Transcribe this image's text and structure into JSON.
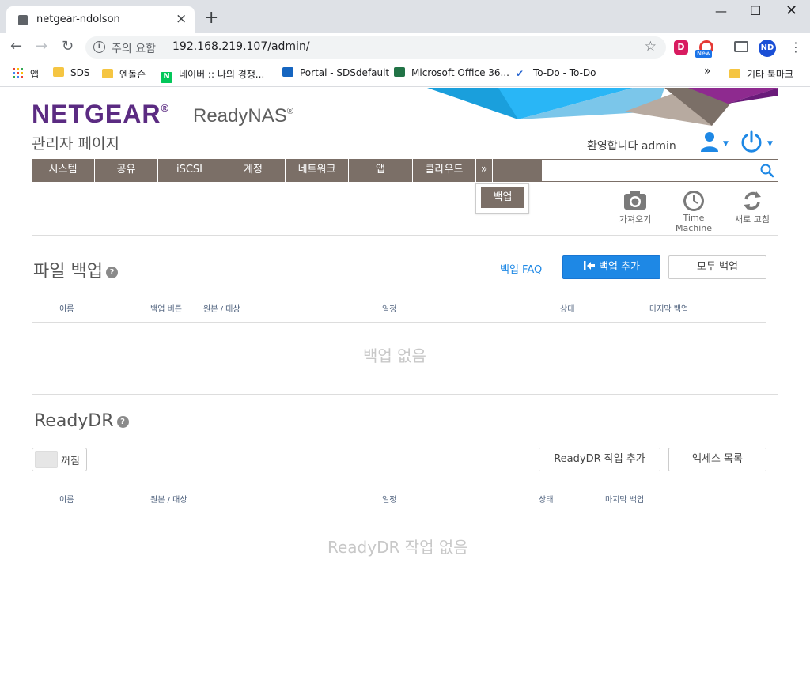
{
  "browser": {
    "tab_title": "netgear-ndolson",
    "new_tab": "+",
    "security_label": "주의 요함",
    "url": "192.168.219.107/admin/",
    "bookmarks": [
      {
        "label": "앱"
      },
      {
        "label": "SDS"
      },
      {
        "label": "엔돌슨"
      },
      {
        "label": "네이버 :: 나의 경쟁..."
      },
      {
        "label": "Portal - SDSdefault"
      },
      {
        "label": "Microsoft Office 36..."
      },
      {
        "label": "To-Do - To-Do"
      }
    ],
    "more_bookmarks": "»",
    "other_bookmarks": "기타 북마크",
    "ext_new_badge": "New",
    "profile_initials": "ND"
  },
  "header": {
    "logo": "NETGEAR",
    "logo_mark": "®",
    "product": "ReadyNAS",
    "product_mark": "®",
    "subtitle": "관리자 페이지",
    "welcome": "환영합니다 admin"
  },
  "nav": {
    "items": [
      "시스템",
      "공유",
      "iSCSI",
      "계정",
      "네트워크",
      "앱",
      "클라우드"
    ],
    "more": "»",
    "dropdown_item": "백업"
  },
  "tools": {
    "import": "가져오기",
    "time_machine": "Time Machine",
    "refresh": "새로 고침"
  },
  "file_backup": {
    "title": "파일 백업",
    "help": "?",
    "faq_link": "백업 FAQ",
    "add_button": "백업 추가",
    "backup_all_button": "모두 백업",
    "columns": [
      "이름",
      "백업 버튼",
      "원본 / 대상",
      "일정",
      "상태",
      "마지막 백업"
    ],
    "empty_text": "백업 없음"
  },
  "readydr": {
    "title": "ReadyDR",
    "help": "?",
    "toggle_label": "꺼짐",
    "add_job_button": "ReadyDR 작업 추가",
    "access_list_button": "액세스 목록",
    "columns": [
      "이름",
      "원본 / 대상",
      "일정",
      "상태",
      "마지막 백업"
    ],
    "empty_text": "ReadyDR 작업 없음"
  },
  "colors": {
    "nav_bg": "#7b6f67",
    "brand_purple": "#5b2b82",
    "accent_blue": "#1e88e5"
  }
}
